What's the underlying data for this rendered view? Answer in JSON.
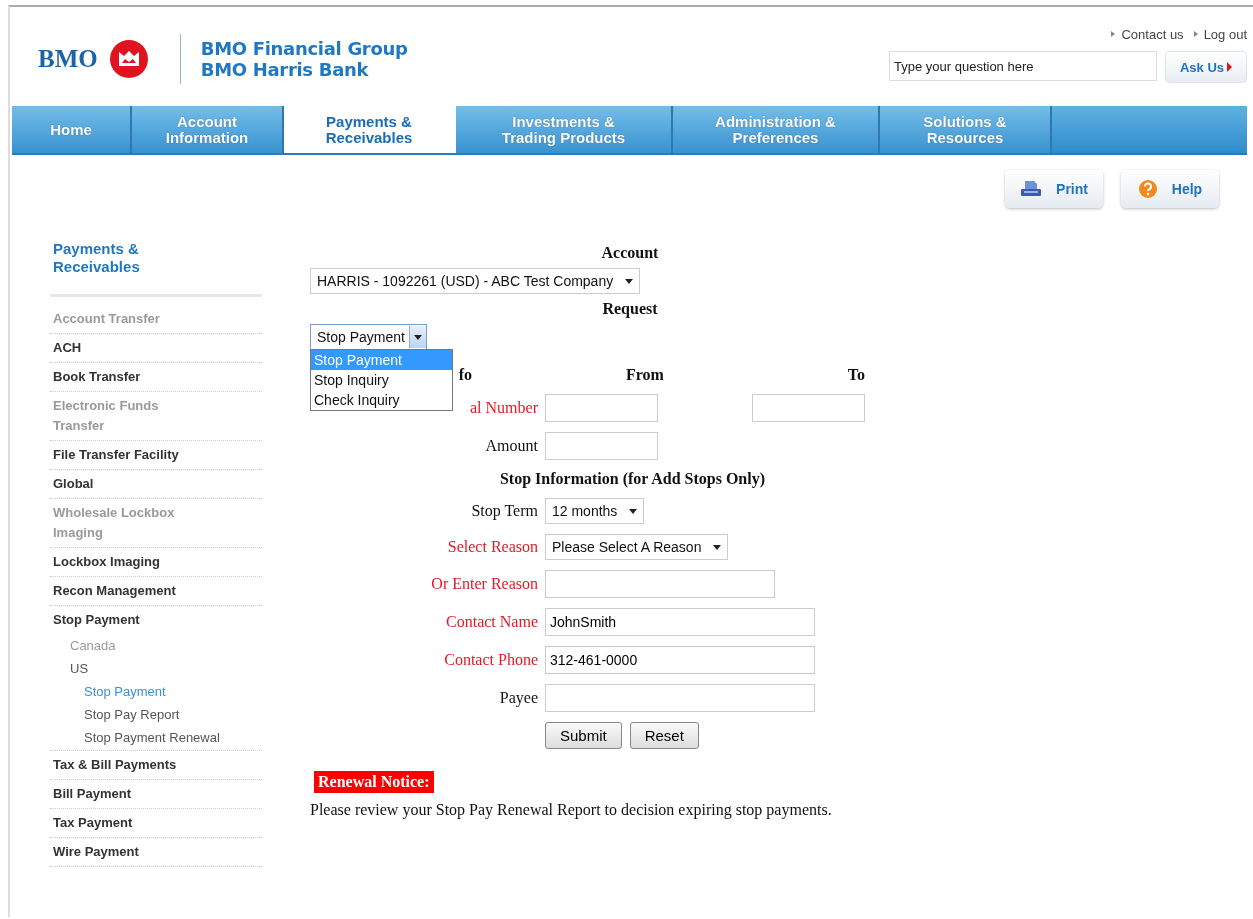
{
  "header": {
    "logo": "BMO",
    "brand_lines": [
      "BMO Financial Group",
      "BMO Harris Bank"
    ],
    "links": [
      "Contact us",
      "Log out"
    ],
    "search": {
      "placeholder": "Type your question here"
    },
    "ask_button": "Ask Us"
  },
  "nav": {
    "tabs": [
      {
        "label": "Home",
        "selected": false
      },
      {
        "label": "Account\nInformation",
        "selected": false
      },
      {
        "label": "Payments &\nReceivables",
        "selected": true
      },
      {
        "label": "Investments &\nTrading Products",
        "selected": false
      },
      {
        "label": "Administration &\nPreferences",
        "selected": false
      },
      {
        "label": "Solutions &\nResources",
        "selected": false
      }
    ]
  },
  "tools": [
    {
      "kind": "print",
      "label": "Print"
    },
    {
      "kind": "help",
      "label": "Help"
    }
  ],
  "sidebar": {
    "title": "Payments &\nReceivables",
    "items": [
      {
        "label": "Account Transfer",
        "disabled": true,
        "selected": false
      },
      {
        "label": "ACH",
        "disabled": false,
        "selected": false
      },
      {
        "label": "Book Transfer",
        "disabled": false,
        "selected": false
      },
      {
        "label": "Electronic Funds\nTransfer",
        "disabled": true,
        "selected": false
      },
      {
        "label": "File Transfer Facility",
        "disabled": false,
        "selected": false
      },
      {
        "label": "Global",
        "disabled": false,
        "selected": false
      },
      {
        "label": "Wholesale Lockbox\nImaging",
        "disabled": true,
        "selected": false
      },
      {
        "label": "Lockbox Imaging",
        "disabled": false,
        "selected": false
      },
      {
        "label": "Recon Management",
        "disabled": false,
        "selected": false
      },
      {
        "label": "Stop Payment",
        "disabled": false,
        "selected": false,
        "children": [
          {
            "label": "Canada",
            "disabled": true,
            "selected": false
          },
          {
            "label": "US",
            "disabled": false,
            "selected": false,
            "children": [
              {
                "label": "Stop Payment",
                "disabled": false,
                "selected": true
              },
              {
                "label": "Stop Pay Report",
                "disabled": false,
                "selected": false
              },
              {
                "label": "Stop Payment Renewal",
                "disabled": false,
                "selected": false
              }
            ]
          }
        ]
      },
      {
        "label": "Tax & Bill Payments",
        "disabled": false,
        "selected": false
      },
      {
        "label": "Bill Payment",
        "disabled": false,
        "selected": false
      },
      {
        "label": "Tax Payment",
        "disabled": false,
        "selected": false
      },
      {
        "label": "Wire Payment",
        "disabled": false,
        "selected": false
      }
    ]
  },
  "form": {
    "account": {
      "label": "Account",
      "value": "HARRIS - 1092261 (USD) - ABC Test Company"
    },
    "request": {
      "label": "Request",
      "value": "Stop Payment",
      "expanded": true,
      "options": [
        {
          "label": "Stop Payment",
          "selected": true
        },
        {
          "label": "Stop Inquiry",
          "selected": false
        },
        {
          "label": "Check Inquiry",
          "selected": false
        }
      ]
    },
    "columns": {
      "column_1": "fo",
      "from": "From",
      "to": "To"
    },
    "rows": [
      {
        "kind": "range",
        "label": "al Number",
        "required": true
      },
      {
        "kind": "text",
        "label": "Amount",
        "required": false
      },
      {
        "kind": "heading",
        "label": "Stop Information (for Add Stops Only)"
      },
      {
        "kind": "select",
        "label": "Stop Term",
        "required": false,
        "value": "12 months"
      },
      {
        "kind": "select",
        "label": "Select Reason",
        "required": true,
        "value": "Please Select A Reason"
      },
      {
        "kind": "text",
        "label": "Or Enter Reason",
        "required": true
      },
      {
        "kind": "text",
        "label": "Contact Name",
        "required": true,
        "value": "JohnSmith"
      },
      {
        "kind": "text",
        "label": "Contact Phone",
        "required": true,
        "value": "312-461-0000"
      },
      {
        "kind": "text",
        "label": "Payee",
        "required": false
      }
    ],
    "buttons": [
      "Submit",
      "Reset"
    ],
    "notice": {
      "title": "Renewal Notice:",
      "text": "Please review your Stop Pay Renewal Report to decision expiring stop payments."
    }
  }
}
